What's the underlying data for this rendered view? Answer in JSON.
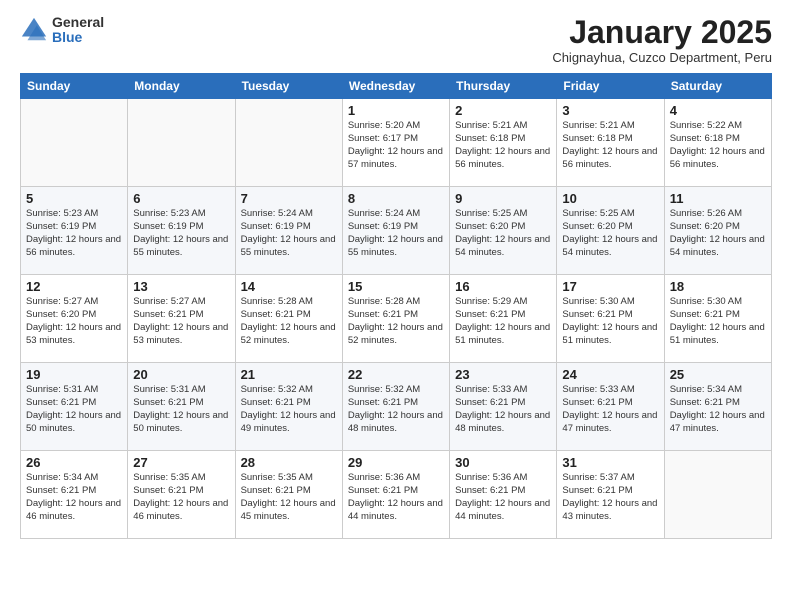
{
  "logo": {
    "general": "General",
    "blue": "Blue"
  },
  "title": "January 2025",
  "subtitle": "Chignayhua, Cuzco Department, Peru",
  "headers": [
    "Sunday",
    "Monday",
    "Tuesday",
    "Wednesday",
    "Thursday",
    "Friday",
    "Saturday"
  ],
  "weeks": [
    [
      {
        "day": "",
        "sunrise": "",
        "sunset": "",
        "daylight": ""
      },
      {
        "day": "",
        "sunrise": "",
        "sunset": "",
        "daylight": ""
      },
      {
        "day": "",
        "sunrise": "",
        "sunset": "",
        "daylight": ""
      },
      {
        "day": "1",
        "sunrise": "Sunrise: 5:20 AM",
        "sunset": "Sunset: 6:17 PM",
        "daylight": "Daylight: 12 hours and 57 minutes."
      },
      {
        "day": "2",
        "sunrise": "Sunrise: 5:21 AM",
        "sunset": "Sunset: 6:18 PM",
        "daylight": "Daylight: 12 hours and 56 minutes."
      },
      {
        "day": "3",
        "sunrise": "Sunrise: 5:21 AM",
        "sunset": "Sunset: 6:18 PM",
        "daylight": "Daylight: 12 hours and 56 minutes."
      },
      {
        "day": "4",
        "sunrise": "Sunrise: 5:22 AM",
        "sunset": "Sunset: 6:18 PM",
        "daylight": "Daylight: 12 hours and 56 minutes."
      }
    ],
    [
      {
        "day": "5",
        "sunrise": "Sunrise: 5:23 AM",
        "sunset": "Sunset: 6:19 PM",
        "daylight": "Daylight: 12 hours and 56 minutes."
      },
      {
        "day": "6",
        "sunrise": "Sunrise: 5:23 AM",
        "sunset": "Sunset: 6:19 PM",
        "daylight": "Daylight: 12 hours and 55 minutes."
      },
      {
        "day": "7",
        "sunrise": "Sunrise: 5:24 AM",
        "sunset": "Sunset: 6:19 PM",
        "daylight": "Daylight: 12 hours and 55 minutes."
      },
      {
        "day": "8",
        "sunrise": "Sunrise: 5:24 AM",
        "sunset": "Sunset: 6:19 PM",
        "daylight": "Daylight: 12 hours and 55 minutes."
      },
      {
        "day": "9",
        "sunrise": "Sunrise: 5:25 AM",
        "sunset": "Sunset: 6:20 PM",
        "daylight": "Daylight: 12 hours and 54 minutes."
      },
      {
        "day": "10",
        "sunrise": "Sunrise: 5:25 AM",
        "sunset": "Sunset: 6:20 PM",
        "daylight": "Daylight: 12 hours and 54 minutes."
      },
      {
        "day": "11",
        "sunrise": "Sunrise: 5:26 AM",
        "sunset": "Sunset: 6:20 PM",
        "daylight": "Daylight: 12 hours and 54 minutes."
      }
    ],
    [
      {
        "day": "12",
        "sunrise": "Sunrise: 5:27 AM",
        "sunset": "Sunset: 6:20 PM",
        "daylight": "Daylight: 12 hours and 53 minutes."
      },
      {
        "day": "13",
        "sunrise": "Sunrise: 5:27 AM",
        "sunset": "Sunset: 6:21 PM",
        "daylight": "Daylight: 12 hours and 53 minutes."
      },
      {
        "day": "14",
        "sunrise": "Sunrise: 5:28 AM",
        "sunset": "Sunset: 6:21 PM",
        "daylight": "Daylight: 12 hours and 52 minutes."
      },
      {
        "day": "15",
        "sunrise": "Sunrise: 5:28 AM",
        "sunset": "Sunset: 6:21 PM",
        "daylight": "Daylight: 12 hours and 52 minutes."
      },
      {
        "day": "16",
        "sunrise": "Sunrise: 5:29 AM",
        "sunset": "Sunset: 6:21 PM",
        "daylight": "Daylight: 12 hours and 51 minutes."
      },
      {
        "day": "17",
        "sunrise": "Sunrise: 5:30 AM",
        "sunset": "Sunset: 6:21 PM",
        "daylight": "Daylight: 12 hours and 51 minutes."
      },
      {
        "day": "18",
        "sunrise": "Sunrise: 5:30 AM",
        "sunset": "Sunset: 6:21 PM",
        "daylight": "Daylight: 12 hours and 51 minutes."
      }
    ],
    [
      {
        "day": "19",
        "sunrise": "Sunrise: 5:31 AM",
        "sunset": "Sunset: 6:21 PM",
        "daylight": "Daylight: 12 hours and 50 minutes."
      },
      {
        "day": "20",
        "sunrise": "Sunrise: 5:31 AM",
        "sunset": "Sunset: 6:21 PM",
        "daylight": "Daylight: 12 hours and 50 minutes."
      },
      {
        "day": "21",
        "sunrise": "Sunrise: 5:32 AM",
        "sunset": "Sunset: 6:21 PM",
        "daylight": "Daylight: 12 hours and 49 minutes."
      },
      {
        "day": "22",
        "sunrise": "Sunrise: 5:32 AM",
        "sunset": "Sunset: 6:21 PM",
        "daylight": "Daylight: 12 hours and 48 minutes."
      },
      {
        "day": "23",
        "sunrise": "Sunrise: 5:33 AM",
        "sunset": "Sunset: 6:21 PM",
        "daylight": "Daylight: 12 hours and 48 minutes."
      },
      {
        "day": "24",
        "sunrise": "Sunrise: 5:33 AM",
        "sunset": "Sunset: 6:21 PM",
        "daylight": "Daylight: 12 hours and 47 minutes."
      },
      {
        "day": "25",
        "sunrise": "Sunrise: 5:34 AM",
        "sunset": "Sunset: 6:21 PM",
        "daylight": "Daylight: 12 hours and 47 minutes."
      }
    ],
    [
      {
        "day": "26",
        "sunrise": "Sunrise: 5:34 AM",
        "sunset": "Sunset: 6:21 PM",
        "daylight": "Daylight: 12 hours and 46 minutes."
      },
      {
        "day": "27",
        "sunrise": "Sunrise: 5:35 AM",
        "sunset": "Sunset: 6:21 PM",
        "daylight": "Daylight: 12 hours and 46 minutes."
      },
      {
        "day": "28",
        "sunrise": "Sunrise: 5:35 AM",
        "sunset": "Sunset: 6:21 PM",
        "daylight": "Daylight: 12 hours and 45 minutes."
      },
      {
        "day": "29",
        "sunrise": "Sunrise: 5:36 AM",
        "sunset": "Sunset: 6:21 PM",
        "daylight": "Daylight: 12 hours and 44 minutes."
      },
      {
        "day": "30",
        "sunrise": "Sunrise: 5:36 AM",
        "sunset": "Sunset: 6:21 PM",
        "daylight": "Daylight: 12 hours and 44 minutes."
      },
      {
        "day": "31",
        "sunrise": "Sunrise: 5:37 AM",
        "sunset": "Sunset: 6:21 PM",
        "daylight": "Daylight: 12 hours and 43 minutes."
      },
      {
        "day": "",
        "sunrise": "",
        "sunset": "",
        "daylight": ""
      }
    ]
  ]
}
